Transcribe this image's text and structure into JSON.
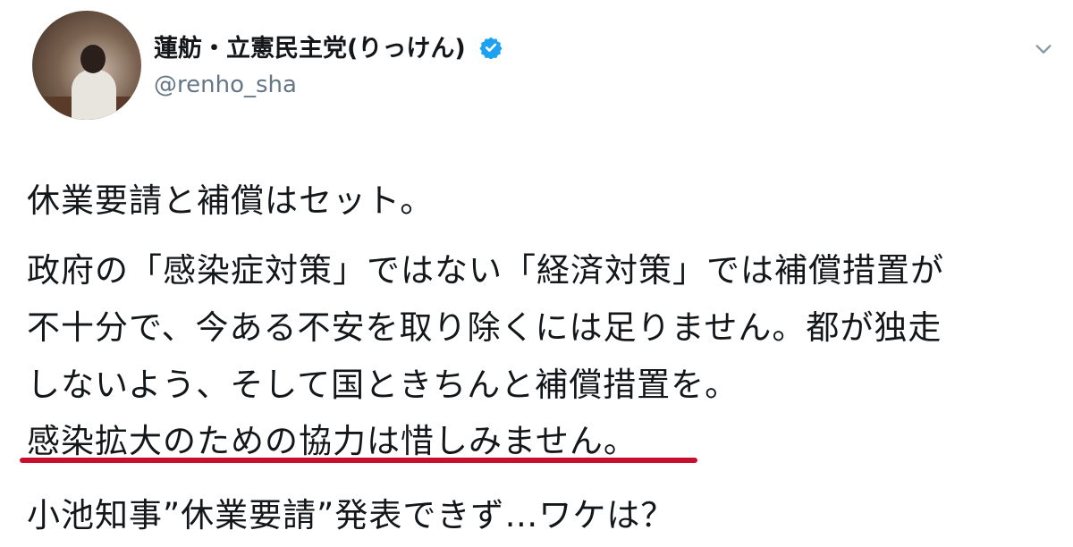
{
  "profile": {
    "display_name": "蓮舫・立憲民主党(りっけん)",
    "handle": "@renho_sha",
    "verified_color": "#1da1f2"
  },
  "tweet": {
    "line1": "休業要請と補償はセット。",
    "line2": "政府の「感染症対策」ではない「経済対策」では補償措置が",
    "line3": "不十分で、今ある不安を取り除くには足りません。都が独走",
    "line4": "しないよう、そして国ときちんと補償措置を。",
    "line5": "感染拡大のための協力は惜しみません。",
    "underline_color": "#c8102e"
  },
  "headline": "小池知事”休業要請”発表できず…ワケは？"
}
